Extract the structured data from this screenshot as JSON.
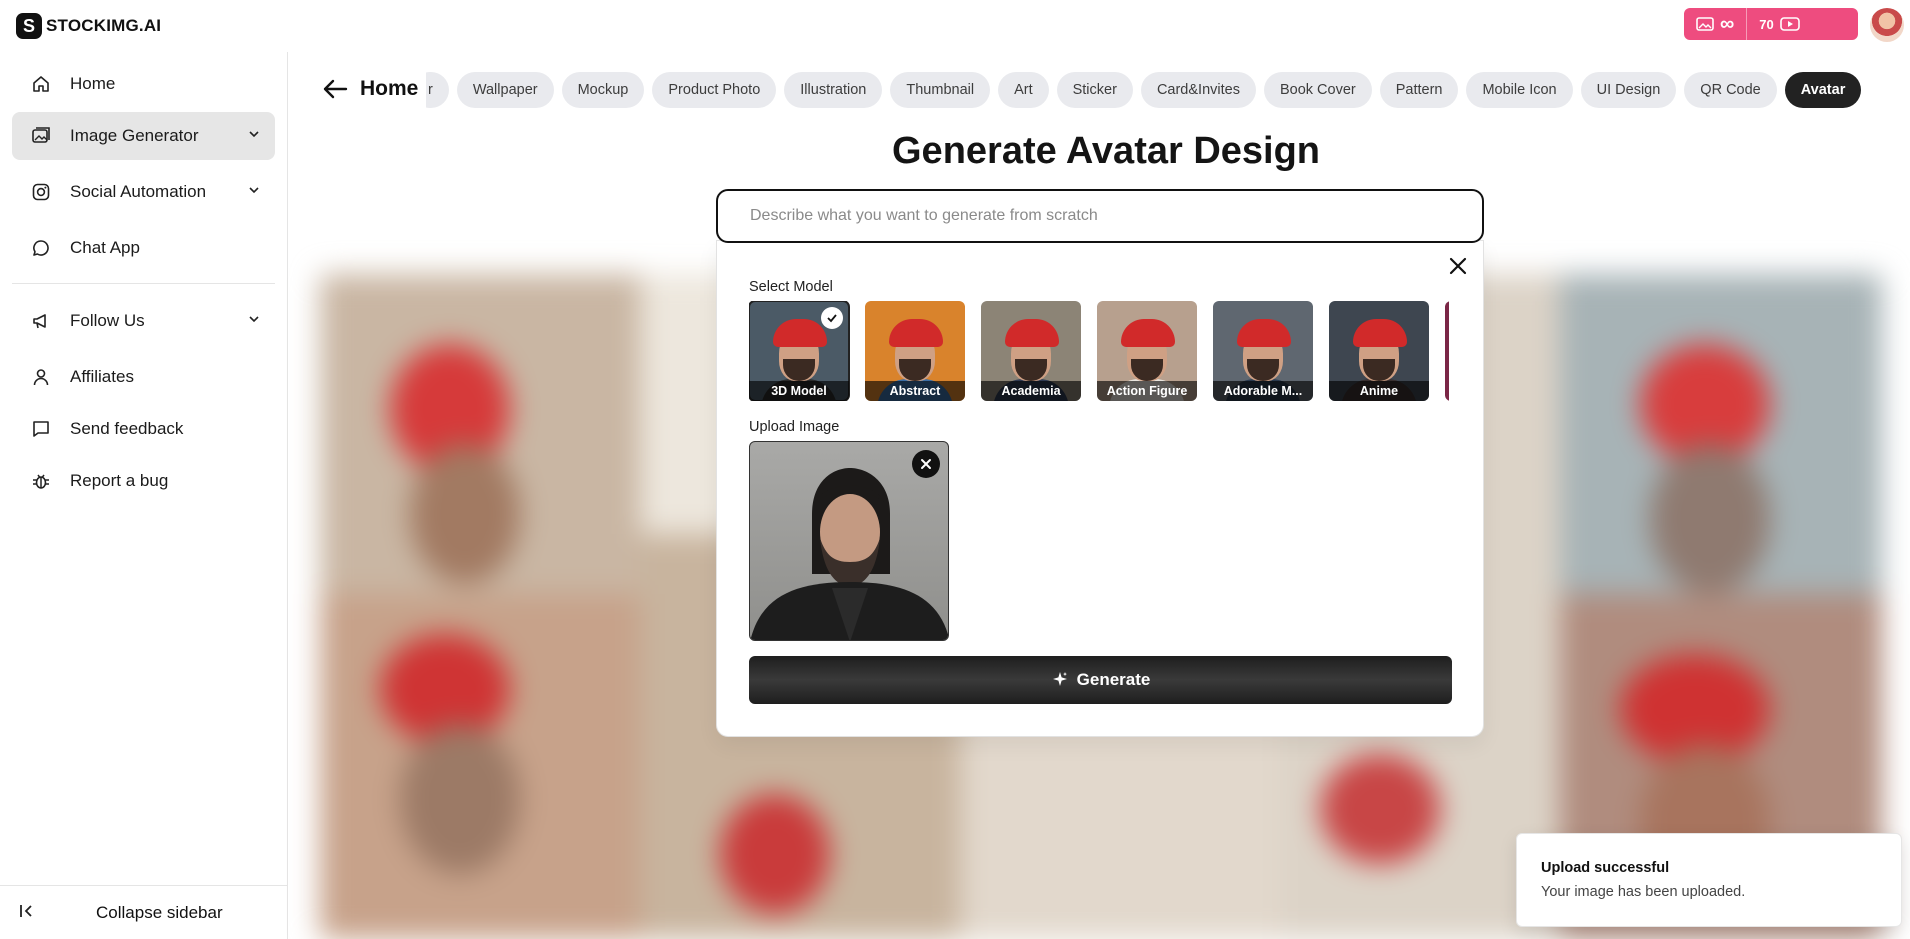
{
  "app": {
    "logo_letter": "S",
    "logo_text": "STOCKIMG.AI",
    "credits": {
      "images": "∞",
      "videos": "70"
    }
  },
  "sidebar": {
    "items": [
      {
        "label": "Home",
        "icon": "home-icon"
      },
      {
        "label": "Image Generator",
        "icon": "image-icon",
        "expandable": true,
        "active": true
      },
      {
        "label": "Social Automation",
        "icon": "instagram-icon",
        "expandable": true
      },
      {
        "label": "Chat App",
        "icon": "chat-icon"
      },
      {
        "label": "Follow Us",
        "icon": "megaphone-icon",
        "expandable": true
      },
      {
        "label": "Affiliates",
        "icon": "user-icon"
      },
      {
        "label": "Send feedback",
        "icon": "message-icon"
      },
      {
        "label": "Report a bug",
        "icon": "bug-icon"
      }
    ],
    "collapse_label": "Collapse sidebar"
  },
  "header": {
    "back_label": "Home",
    "chips": [
      "r",
      "Wallpaper",
      "Mockup",
      "Product Photo",
      "Illustration",
      "Thumbnail",
      "Art",
      "Sticker",
      "Card&Invites",
      "Book Cover",
      "Pattern",
      "Mobile Icon",
      "UI Design",
      "QR Code",
      "Avatar"
    ],
    "active_chip": "Avatar"
  },
  "main": {
    "title": "Generate Avatar Design",
    "search_placeholder": "Describe what you want to generate from scratch"
  },
  "panel": {
    "select_model_label": "Select Model",
    "models": [
      {
        "name": "3D Model",
        "selected": true,
        "bg": "#4b5a66",
        "body": "#2c2c2c"
      },
      {
        "name": "Abstract",
        "selected": false,
        "bg": "#d9832c",
        "body": "#3b6ea5"
      },
      {
        "name": "Academia",
        "selected": false,
        "bg": "#8c8476",
        "body": "#2f3a52"
      },
      {
        "name": "Action Figure",
        "selected": false,
        "bg": "#b7a08e",
        "body": "#e9e5df"
      },
      {
        "name": "Adorable M...",
        "selected": false,
        "bg": "#5f6770",
        "body": "#2a3a4e"
      },
      {
        "name": "Anime",
        "selected": false,
        "bg": "#3e4650",
        "body": "#3a3030"
      },
      {
        "name": "",
        "selected": false,
        "bg": "#7a2646",
        "body": "#7a2646"
      }
    ],
    "upload_label": "Upload Image",
    "generate_label": "Generate"
  },
  "toast": {
    "title": "Upload successful",
    "message": "Your image has been uploaded."
  },
  "colors": {
    "accent": "#ee4c7f",
    "dark": "#111111",
    "chip_bg": "#e9eaee"
  }
}
